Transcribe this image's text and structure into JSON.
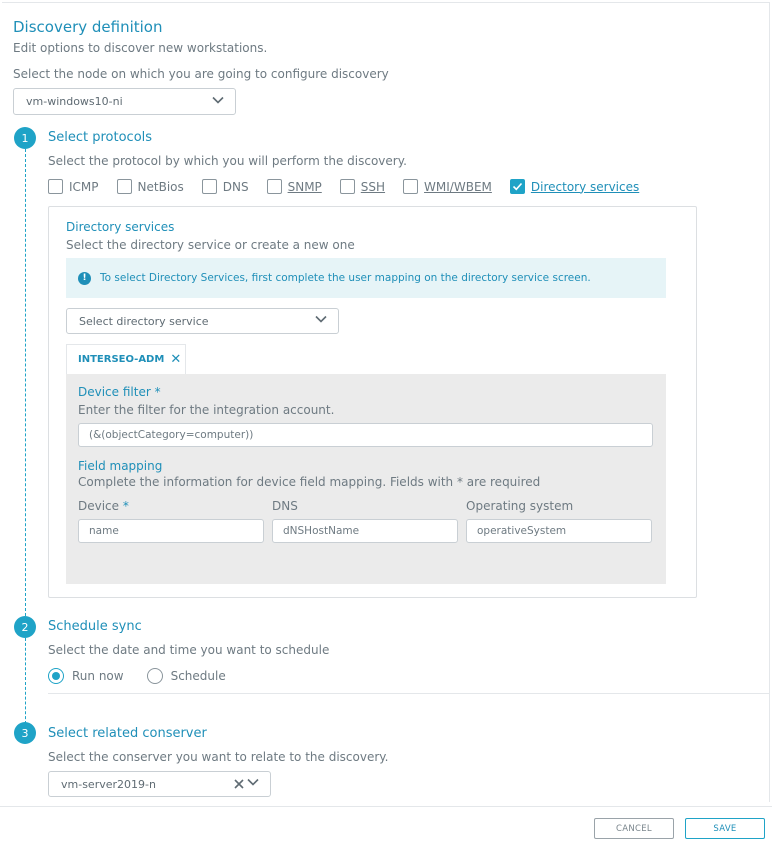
{
  "header": {
    "title": "Discovery definition",
    "subtitle": "Edit options to discover new workstations.",
    "node_label": "Select the node on which you are going to configure discovery",
    "node_value": "vm-windows10-ni"
  },
  "step1": {
    "number": "1",
    "title": "Select protocols",
    "description": "Select the protocol by which you will perform the discovery.",
    "protocols": [
      {
        "label": "ICMP",
        "checked": false
      },
      {
        "label": "NetBios",
        "checked": false
      },
      {
        "label": "DNS",
        "checked": false
      },
      {
        "label": "SNMP",
        "checked": false
      },
      {
        "label": "SSH",
        "checked": false
      },
      {
        "label": "WMI/WBEM",
        "checked": false
      },
      {
        "label": "Directory services",
        "checked": true
      }
    ],
    "directory": {
      "title": "Directory services",
      "description": "Select the directory service or create a new one",
      "info": "To select Directory Services, first complete the user mapping on the directory service screen.",
      "select_placeholder": "Select directory service",
      "tab_label": "INTERSEO-ADM",
      "tab_close": "✕",
      "device_filter_label": "Device filter",
      "required_mark": "*",
      "device_filter_desc": "Enter the filter for the integration account.",
      "device_filter_value": "(&(objectCategory=computer))",
      "field_mapping_label": "Field mapping",
      "field_mapping_desc": "Complete the information for device field mapping. Fields with * are required",
      "device_label": "Device",
      "device_value": "name",
      "dns_label": "DNS",
      "dns_value": "dNSHostName",
      "os_label": "Operating system",
      "os_value": "operativeSystem"
    }
  },
  "step2": {
    "number": "2",
    "title": "Schedule sync",
    "description": "Select the date and time you want to schedule",
    "run_now": "Run now",
    "schedule": "Schedule",
    "selected": "run_now"
  },
  "step3": {
    "number": "3",
    "title": "Select related conserver",
    "description": "Select the conserver you want to relate to the discovery.",
    "conserver_value": "vm-server2019-n"
  },
  "footer": {
    "cancel": "CANCEL",
    "save": "SAVE"
  },
  "colors": {
    "accent": "#1fa3c7",
    "text_blue": "#1f8fb8",
    "info_bg": "#e6f4f7",
    "panel_bg": "#ebebeb"
  }
}
